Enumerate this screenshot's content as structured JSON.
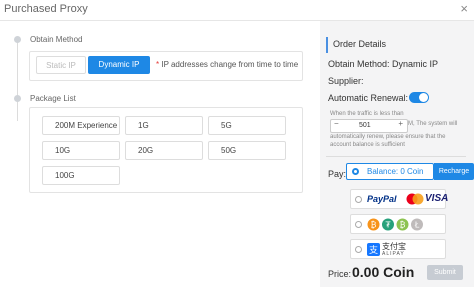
{
  "window": {
    "title": "Purchased Proxy",
    "close_glyph": "×"
  },
  "left": {
    "obtain_method_label": "Obtain Method",
    "methods": [
      "Static IP",
      "Dynamic IP"
    ],
    "selected_method": "Dynamic IP",
    "method_note_star": "*",
    "method_note": " IP addresses change from time to time",
    "package_list_label": "Package List",
    "packages": [
      "200M Experience",
      "1G",
      "5G",
      "10G",
      "20G",
      "50G",
      "100G"
    ]
  },
  "order": {
    "header": "Order Details",
    "method_line": "Obtain Method: Dynamic IP",
    "supplier_line": "Supplier:",
    "auto_renewal_label": "Automatic Renewal:",
    "auto_renewal_on": true,
    "traffic_note_top": "When the traffic is less than",
    "traffic_value": "501",
    "traffic_unit": "M,  The system will",
    "traffic_note_bottom": "automatically renew, please ensure that the account balance is sufficient",
    "minus": "−",
    "plus": "+",
    "pay_label": "Pay:",
    "balance_text": "Balance: 0 Coin",
    "recharge_label": "Recharge",
    "paypal_text": "PayPal",
    "visa_text": "VISA",
    "alipay_cn": "支付宝",
    "alipay_en": "ALIPAY",
    "price_label": "Price:",
    "price_value": "0.00 Coin",
    "submit_label": "Submit"
  },
  "colors": {
    "accent": "#1e88e5",
    "paypal_blue": "#003087",
    "paypal_light": "#009cde",
    "visa_blue": "#1a1f71",
    "mc_red": "#eb001b",
    "mc_orange": "#f79e1b"
  }
}
